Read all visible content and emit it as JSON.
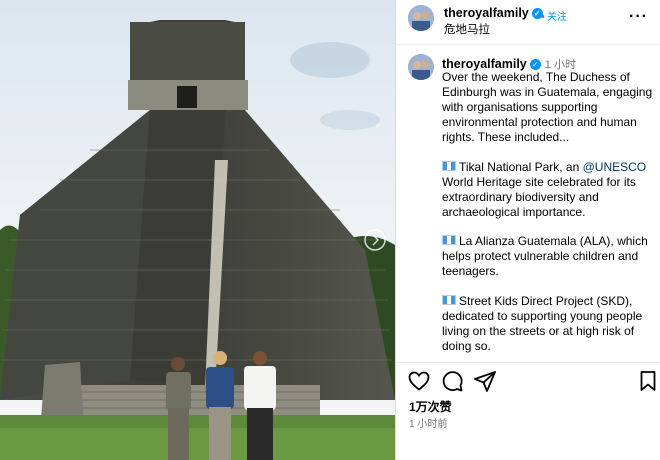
{
  "post": {
    "username": "theroyalfamily",
    "follow_label": "关注",
    "location": "危地马拉",
    "time_ago": "1 小时",
    "likes": "1万次赞",
    "posted_time": "1 小时前"
  },
  "caption": {
    "intro": "Over the weekend, The Duchess of Edinburgh was in Guatemala, engaging with organisations supporting environmental protection and human rights. These included...",
    "item1_prefix": "Tikal National Park, an ",
    "item1_mention": "@UNESCO",
    "item1_suffix": " World Heritage site celebrated for its extraordinary biodiversity and archaeological importance.",
    "item2": "La Alianza Guatemala (ALA), which helps protect vulnerable children and teenagers.",
    "item3": "Street Kids Direct Project (SKD), dedicated to supporting young people living on the streets or at high risk of doing so."
  },
  "icons": {
    "more": "more-options-icon",
    "like": "heart-icon",
    "comment": "comment-icon",
    "share": "share-icon",
    "save": "bookmark-icon",
    "flag": "guatemala-flag-icon",
    "verified": "verified-badge-icon"
  },
  "colors": {
    "link": "#00376b",
    "accent": "#0095f6",
    "muted": "#737373"
  }
}
